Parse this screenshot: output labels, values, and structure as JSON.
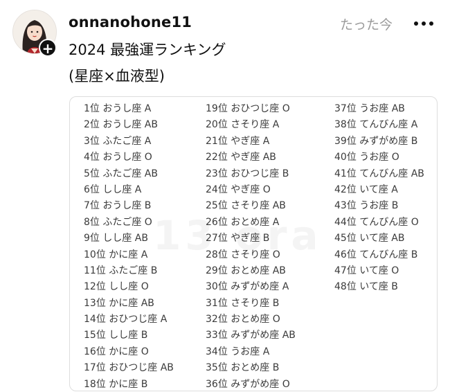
{
  "post": {
    "username": "onnanohone11",
    "timestamp": "たった今",
    "text_line1": "2024 最強運ランキング",
    "text_line2": "(星座×血液型)",
    "follow_icon": "plus-icon",
    "more_icon": "more-horizontal-icon"
  },
  "image": {
    "watermark": "13 ora",
    "columns": [
      [
        "1位 おうし座 A",
        "2位 おうし座 AB",
        "3位 ふたご座 A",
        "4位 おうし座 O",
        "5位 ふたご座 AB",
        "6位 しし座 A",
        "7位 おうし座 B",
        "8位 ふたご座 O",
        "9位 しし座 AB",
        "10位 かに座 A",
        "11位 ふたご座 B",
        "12位 しし座 O",
        "13位 かに座 AB",
        "14位 おひつじ座 A",
        "15位 しし座 B",
        "16位 かに座 O",
        "17位 おひつじ座 AB",
        "18位 かに座 B"
      ],
      [
        "19位 おひつじ座 O",
        "20位 さそり座 A",
        "21位 やぎ座 A",
        "22位 やぎ座 AB",
        "23位 おひつじ座 B",
        "24位 やぎ座 O",
        "25位 さそり座 AB",
        "26位 おとめ座 A",
        "27位 やぎ座 B",
        "28位 さそり座 O",
        "29位 おとめ座 AB",
        "30位 みずがめ座 A",
        "31位 さそり座 B",
        "32位 おとめ座 O",
        "33位 みずがめ座 AB",
        "34位 うお座 A",
        "35位 おとめ座 B",
        "36位 みずがめ座 O"
      ],
      [
        "37位 うお座 AB",
        "38位 てんびん座 A",
        "39位 みずがめ座 B",
        "40位 うお座 O",
        "41位 てんびん座 AB",
        "42位 いて座 A",
        "43位 うお座 B",
        "44位 てんびん座 O",
        "45位 いて座 AB",
        "46位 てんびん座 B",
        "47位 いて座 O",
        "48位 いて座 B"
      ]
    ]
  }
}
